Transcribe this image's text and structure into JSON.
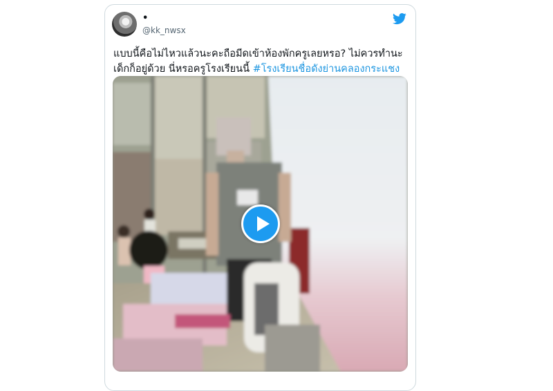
{
  "tweet": {
    "display_name": "•",
    "handle": "@kk_nwsx",
    "text_line1": "แบบนี้คือไม่ไหวแล้วนะคะถือมีดเข้าห้องพักครูเลยหรอ? ไม่ควรทำนะ",
    "text_line2": "เด็กก็อยู่ด้วย นี่หรอครูโรงเรียนนี้ ",
    "hashtag": "#โรงเรียนชื่อดังย่านคลองกระแชง"
  },
  "icons": {
    "brand": "twitter-bird-icon",
    "media": "play-icon"
  },
  "colors": {
    "accent": "#1d9bf0",
    "hashtag": "#1b95e0",
    "text": "#0f1419",
    "secondary_text": "#536471",
    "card_border": "#cfd9de"
  }
}
